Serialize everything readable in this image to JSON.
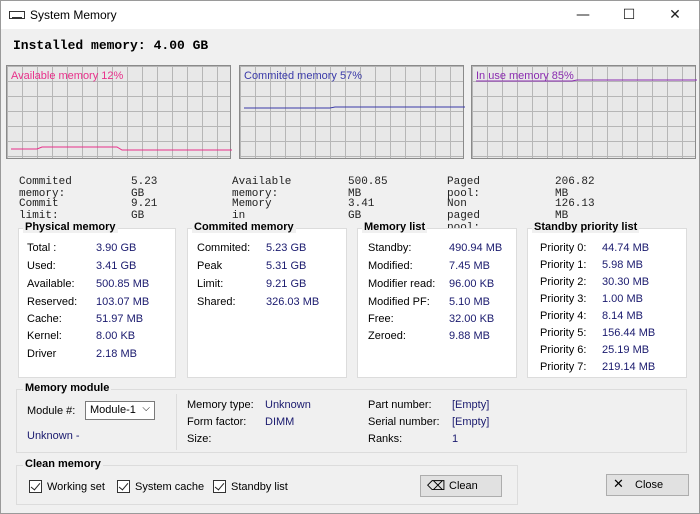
{
  "window": {
    "title": "System Memory",
    "minimize": "—",
    "maximize": "☐",
    "close": "✕"
  },
  "installed": {
    "label": "Installed memory:",
    "value": "4.00 GB"
  },
  "graphs": [
    {
      "label": "Available memory 12%",
      "color": "#e8308a",
      "percent": 12
    },
    {
      "label": "Commited memory 57%",
      "color": "#3a3aa8",
      "percent": 57
    },
    {
      "label": "In use memory 85%",
      "color": "#8a2bb0",
      "percent": 85
    }
  ],
  "summary": {
    "commited_memory": {
      "label": "Commited memory:",
      "value": "5.23 GB"
    },
    "commit_limit": {
      "label": "Commit limit:",
      "value": "9.21 GB"
    },
    "available_memory": {
      "label": "Available memory:",
      "value": "500.85 MB"
    },
    "memory_in_use": {
      "label": "Memory in use:",
      "value": "3.41 GB"
    },
    "paged_pool": {
      "label": "Paged pool:",
      "value": "206.82 MB"
    },
    "non_paged_pool": {
      "label": "Non paged pool:",
      "value": "126.13 MB"
    }
  },
  "physical": {
    "title": "Physical memory",
    "rows": [
      {
        "k": "Total :",
        "v": "3.90 GB"
      },
      {
        "k": "Used:",
        "v": "3.41 GB"
      },
      {
        "k": "Available:",
        "v": "500.85 MB"
      },
      {
        "k": "Reserved:",
        "v": "103.07 MB"
      },
      {
        "k": "Cache:",
        "v": "51.97 MB"
      },
      {
        "k": "Kernel:",
        "v": "8.00 KB"
      },
      {
        "k": "Driver",
        "v": "2.18 MB"
      }
    ]
  },
  "commited": {
    "title": "Commited memory",
    "rows": [
      {
        "k": "Commited:",
        "v": "5.23 GB"
      },
      {
        "k": "Peak",
        "v": "5.31 GB"
      },
      {
        "k": "Limit:",
        "v": "9.21 GB"
      },
      {
        "k": "Shared:",
        "v": "326.03 MB"
      }
    ]
  },
  "memlist": {
    "title": "Memory list",
    "rows": [
      {
        "k": "Standby:",
        "v": "490.94 MB"
      },
      {
        "k": "Modified:",
        "v": "7.45 MB"
      },
      {
        "k": "Modifier read:",
        "v": "96.00 KB"
      },
      {
        "k": "Modified PF:",
        "v": "5.10 MB"
      },
      {
        "k": "Free:",
        "v": "32.00 KB"
      },
      {
        "k": "Zeroed:",
        "v": "9.88 MB"
      }
    ]
  },
  "standby": {
    "title": "Standby priority list",
    "rows": [
      {
        "k": "Priority 0:",
        "v": "44.74 MB"
      },
      {
        "k": "Priority 1:",
        "v": "5.98 MB"
      },
      {
        "k": "Priority 2:",
        "v": "30.30 MB"
      },
      {
        "k": "Priority 3:",
        "v": "1.00 MB"
      },
      {
        "k": "Priority 4:",
        "v": "8.14 MB"
      },
      {
        "k": "Priority 5:",
        "v": "156.44 MB"
      },
      {
        "k": "Priority 6:",
        "v": "25.19 MB"
      },
      {
        "k": "Priority 7:",
        "v": "219.14 MB"
      }
    ]
  },
  "module": {
    "title": "Memory module",
    "module_label": "Module #:",
    "module_selected": "Module-1",
    "status": "Unknown -",
    "memory_type": {
      "k": "Memory type:",
      "v": "Unknown"
    },
    "form_factor": {
      "k": "Form factor:",
      "v": "DIMM"
    },
    "size": {
      "k": "Size:",
      "v": ""
    },
    "part_number": {
      "k": "Part number:",
      "v": "[Empty]"
    },
    "serial_number": {
      "k": "Serial number:",
      "v": "[Empty]"
    },
    "ranks": {
      "k": "Ranks:",
      "v": "1"
    }
  },
  "clean": {
    "title": "Clean memory",
    "working_set": "Working set",
    "system_cache": "System cache",
    "standby_list": "Standby list",
    "clean_button": "Clean",
    "close_button": "Close"
  }
}
